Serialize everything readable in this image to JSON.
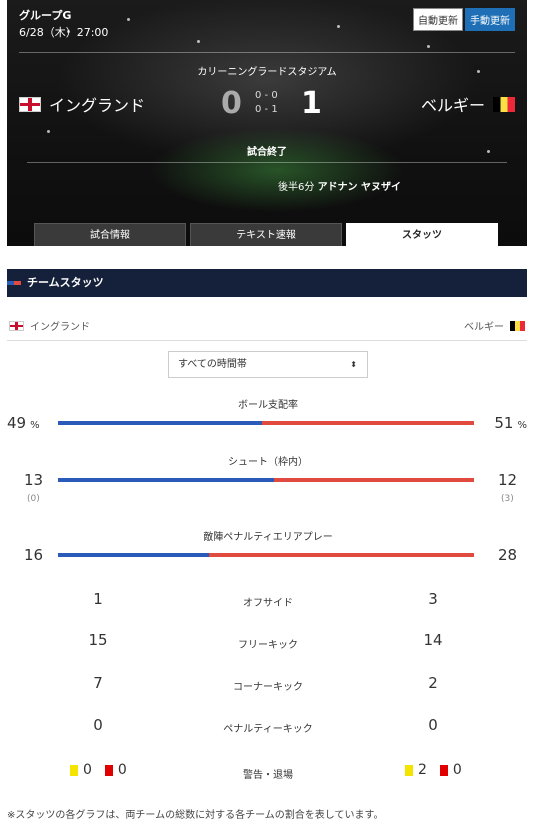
{
  "match": {
    "group": "グループG",
    "datetime": "6/28（木）27:00",
    "refresh": {
      "auto": "自動更新",
      "manual": "手動更新"
    },
    "stadium": "カリーニングラードスタジアム",
    "home": {
      "name": "イングランド",
      "score": "0",
      "flag": "england-flag"
    },
    "away": {
      "name": "ベルギー",
      "score": "1",
      "flag": "belgium-flag"
    },
    "halves": {
      "first": "0 - 0",
      "second": "0 - 1"
    },
    "status": "試合終了",
    "goal": {
      "time": "後半6分",
      "player": "アドナン ヤヌザイ"
    },
    "tabs": [
      "試合情報",
      "テキスト速報",
      "スタッツ"
    ],
    "active_tab": "スタッツ"
  },
  "stats": {
    "section_title": "チームスタッツ",
    "home_team": "イングランド",
    "away_team": "ベルギー",
    "period_select": "すべての時間帯",
    "possession": {
      "label": "ボール支配率",
      "home": "49",
      "away": "51",
      "unit": "%",
      "home_share": 0.49
    },
    "shots": {
      "label": "シュート（枠内）",
      "home": "13",
      "away": "12",
      "home_on": "(0)",
      "away_on": "(3)",
      "home_share": 0.52
    },
    "box_plays": {
      "label": "敵陣ペナルティエリアプレー",
      "home": "16",
      "away": "28",
      "home_share": 0.364
    },
    "rows": [
      {
        "label": "オフサイド",
        "home": "1",
        "away": "3"
      },
      {
        "label": "フリーキック",
        "home": "15",
        "away": "14"
      },
      {
        "label": "コーナーキック",
        "home": "7",
        "away": "2"
      },
      {
        "label": "ペナルティーキック",
        "home": "0",
        "away": "0"
      }
    ],
    "cards": {
      "label": "警告・退場",
      "home_yellow": "0",
      "home_red": "0",
      "away_yellow": "2",
      "away_red": "0"
    },
    "note": "※スタッツの各グラフは、両チームの総数に対する各チームの割合を表しています。"
  },
  "colors": {
    "home": "#2a5bb8",
    "away": "#e04a3f",
    "header": "#15203a",
    "manual_button": "#1f6fb6"
  }
}
